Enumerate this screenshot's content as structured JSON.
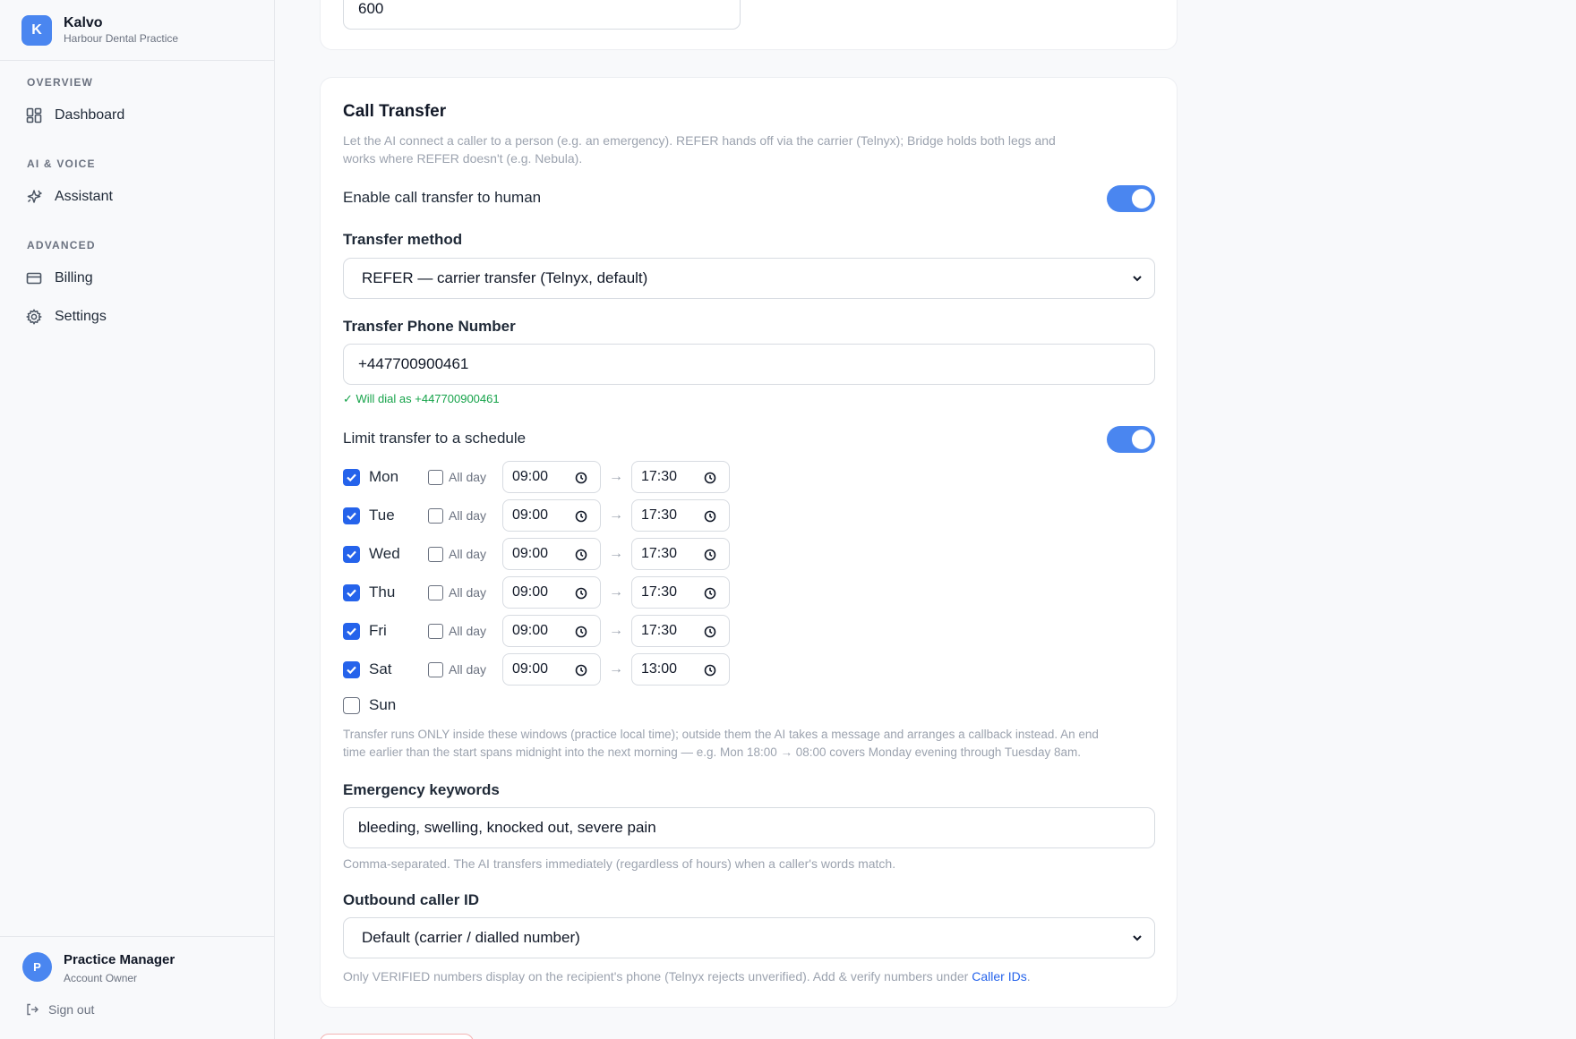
{
  "brand": {
    "logo_letter": "K",
    "name": "Kalvo",
    "subtitle": "Harbour Dental Practice"
  },
  "sidebar": {
    "sections": [
      {
        "title": "OVERVIEW",
        "items": [
          {
            "label": "Dashboard",
            "icon": "dashboard-grid-icon"
          }
        ]
      },
      {
        "title": "AI & VOICE",
        "items": [
          {
            "label": "Assistant",
            "icon": "sparkles-icon"
          }
        ]
      },
      {
        "title": "ADVANCED",
        "items": [
          {
            "label": "Billing",
            "icon": "credit-card-icon"
          },
          {
            "label": "Settings",
            "icon": "gear-icon"
          }
        ]
      }
    ]
  },
  "user": {
    "initial": "P",
    "name": "Practice Manager",
    "role": "Account Owner",
    "signout_label": "Sign out"
  },
  "top_card": {
    "input_value": "600"
  },
  "call_transfer": {
    "title": "Call Transfer",
    "description_line1": "Let the AI connect a caller to a person (e.g. an emergency). REFER hands off via the carrier (Telnyx); Bridge holds both legs and",
    "description_line2": "works where REFER doesn't (e.g. Nebula).",
    "enable_label": "Enable call transfer to human",
    "enable_on": true,
    "method_label": "Transfer method",
    "method_value": "REFER — carrier transfer (Telnyx, default)",
    "phone_label": "Transfer Phone Number",
    "phone_value": "+447700900461",
    "phone_hint": "✓ Will dial as +447700900461",
    "schedule_label": "Limit transfer to a schedule",
    "schedule_on": true,
    "allday_label": "All day",
    "arrow": "→",
    "schedule": [
      {
        "day": "Mon",
        "checked": true,
        "start": "09:00",
        "end": "17:30"
      },
      {
        "day": "Tue",
        "checked": true,
        "start": "09:00",
        "end": "17:30"
      },
      {
        "day": "Wed",
        "checked": true,
        "start": "09:00",
        "end": "17:30"
      },
      {
        "day": "Thu",
        "checked": true,
        "start": "09:00",
        "end": "17:30"
      },
      {
        "day": "Fri",
        "checked": true,
        "start": "09:00",
        "end": "17:30"
      },
      {
        "day": "Sat",
        "checked": true,
        "start": "09:00",
        "end": "13:00"
      },
      {
        "day": "Sun",
        "checked": false
      }
    ],
    "schedule_note_line1": "Transfer runs ONLY inside these windows (practice local time); outside them the AI takes a message and arranges a callback instead. An end",
    "schedule_note_line2": "time earlier than the start spans midnight into the next morning — e.g. Mon 18:00 → 08:00 covers Monday evening through Tuesday 8am.",
    "keywords_label": "Emergency keywords",
    "keywords_value": "bleeding, swelling, knocked out, severe pain",
    "keywords_hint": "Comma-separated. The AI transfers immediately (regardless of hours) when a caller's words match.",
    "caller_id_label": "Outbound caller ID",
    "caller_id_value": "Default (carrier / dialled number)",
    "caller_id_hint_prefix": "Only VERIFIED numbers display on the recipient's phone (Telnyx rejects unverified). Add & verify numbers under ",
    "caller_id_hint_link": "Caller IDs",
    "caller_id_hint_suffix": "."
  },
  "colors": {
    "accent": "#4a86f0",
    "checkbox": "#2563eb",
    "success": "#16a34a",
    "muted": "#9ca3af"
  }
}
